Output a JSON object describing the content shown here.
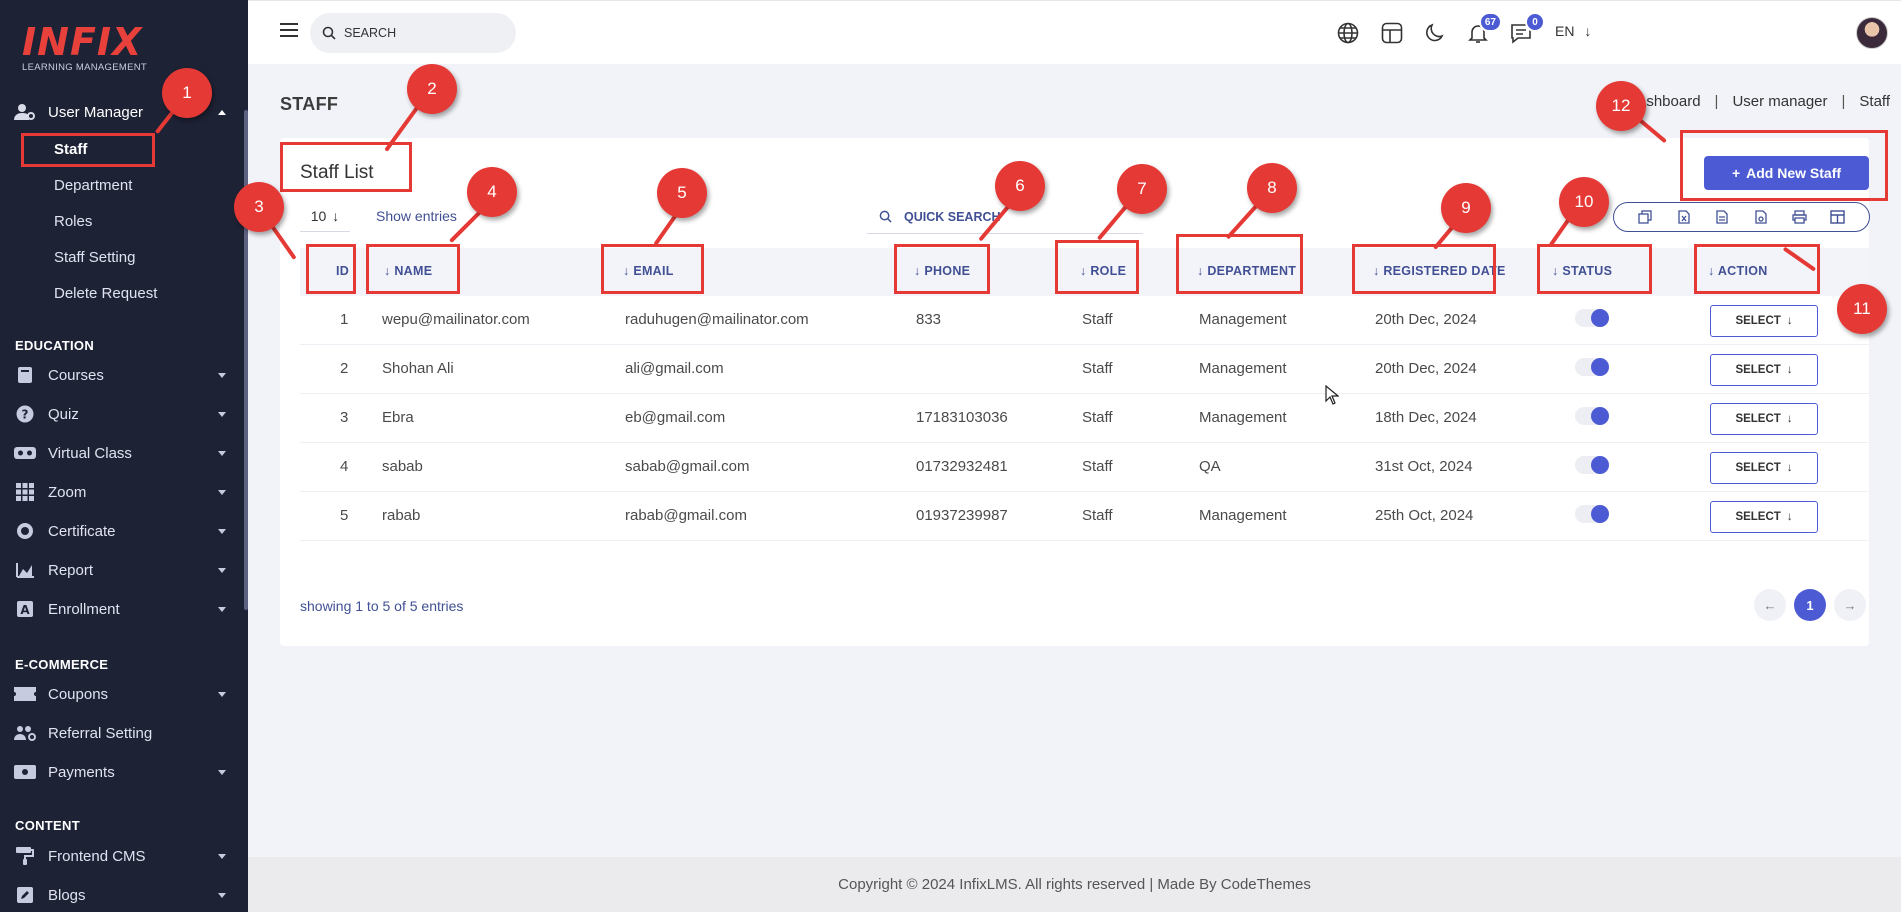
{
  "app": {
    "logo_text": "INFIX",
    "logo_subtitle": "LEARNING MANAGEMENT",
    "copyright": "Copyright © 2024 InfixLMS. All rights reserved | Made By CodeThemes"
  },
  "sidebar": {
    "user_manager": {
      "label": "User Manager",
      "sub_items": [
        "Staff",
        "Department",
        "Roles",
        "Staff Setting",
        "Delete Request"
      ]
    },
    "education": {
      "heading": "EDUCATION",
      "items": [
        "Courses",
        "Quiz",
        "Virtual Class",
        "Zoom",
        "Certificate",
        "Report",
        "Enrollment"
      ]
    },
    "ecommerce": {
      "heading": "E-COMMERCE",
      "items": [
        "Coupons",
        "Referral Setting",
        "Payments"
      ]
    },
    "content": {
      "heading": "CONTENT",
      "items": [
        "Frontend CMS",
        "Blogs"
      ]
    }
  },
  "topbar": {
    "search_placeholder": "SEARCH",
    "language": "EN",
    "notification_count": "67",
    "message_count": "0"
  },
  "page": {
    "title": "STAFF",
    "breadcrumb": [
      "Dashboard",
      "User manager",
      "Staff"
    ]
  },
  "card": {
    "title": "Staff List",
    "add_button": "Add New Staff",
    "entries_value": "10",
    "show_entries_label": "Show entries",
    "quick_search_placeholder": "QUICK SEARCH",
    "columns": [
      "ID",
      "NAME",
      "EMAIL",
      "PHONE",
      "ROLE",
      "DEPARTMENT",
      "REGISTERED DATE",
      "STATUS",
      "ACTION"
    ],
    "rows": [
      {
        "id": "1",
        "name": "wepu@mailinator.com",
        "email": "raduhugen@mailinator.com",
        "phone": "833",
        "role": "Staff",
        "department": "Management",
        "date": "20th Dec, 2024",
        "status": true,
        "action": "SELECT"
      },
      {
        "id": "2",
        "name": "Shohan Ali",
        "email": "ali@gmail.com",
        "phone": "",
        "role": "Staff",
        "department": "Management",
        "date": "20th Dec, 2024",
        "status": true,
        "action": "SELECT"
      },
      {
        "id": "3",
        "name": "Ebra",
        "email": "eb@gmail.com",
        "phone": "17183103036",
        "role": "Staff",
        "department": "Management",
        "date": "18th Dec, 2024",
        "status": true,
        "action": "SELECT"
      },
      {
        "id": "4",
        "name": "sabab",
        "email": "sabab@gmail.com",
        "phone": "01732932481",
        "role": "Staff",
        "department": "QA",
        "date": "31st Oct, 2024",
        "status": true,
        "action": "SELECT"
      },
      {
        "id": "5",
        "name": "rabab",
        "email": "rabab@gmail.com",
        "phone": "01937239987",
        "role": "Staff",
        "department": "Management",
        "date": "25th Oct, 2024",
        "status": true,
        "action": "SELECT"
      }
    ],
    "showing_text": "showing 1 to 5 of 5 entries",
    "current_page": "1"
  },
  "annotations": [
    "1",
    "2",
    "3",
    "4",
    "5",
    "6",
    "7",
    "8",
    "9",
    "10",
    "11",
    "12"
  ],
  "colors": {
    "sidebar_bg": "#1e2235",
    "accent": "#4c5bd4",
    "text_primary": "#415094",
    "annotation_red": "#e53935",
    "logo_red": "#e8413c"
  }
}
